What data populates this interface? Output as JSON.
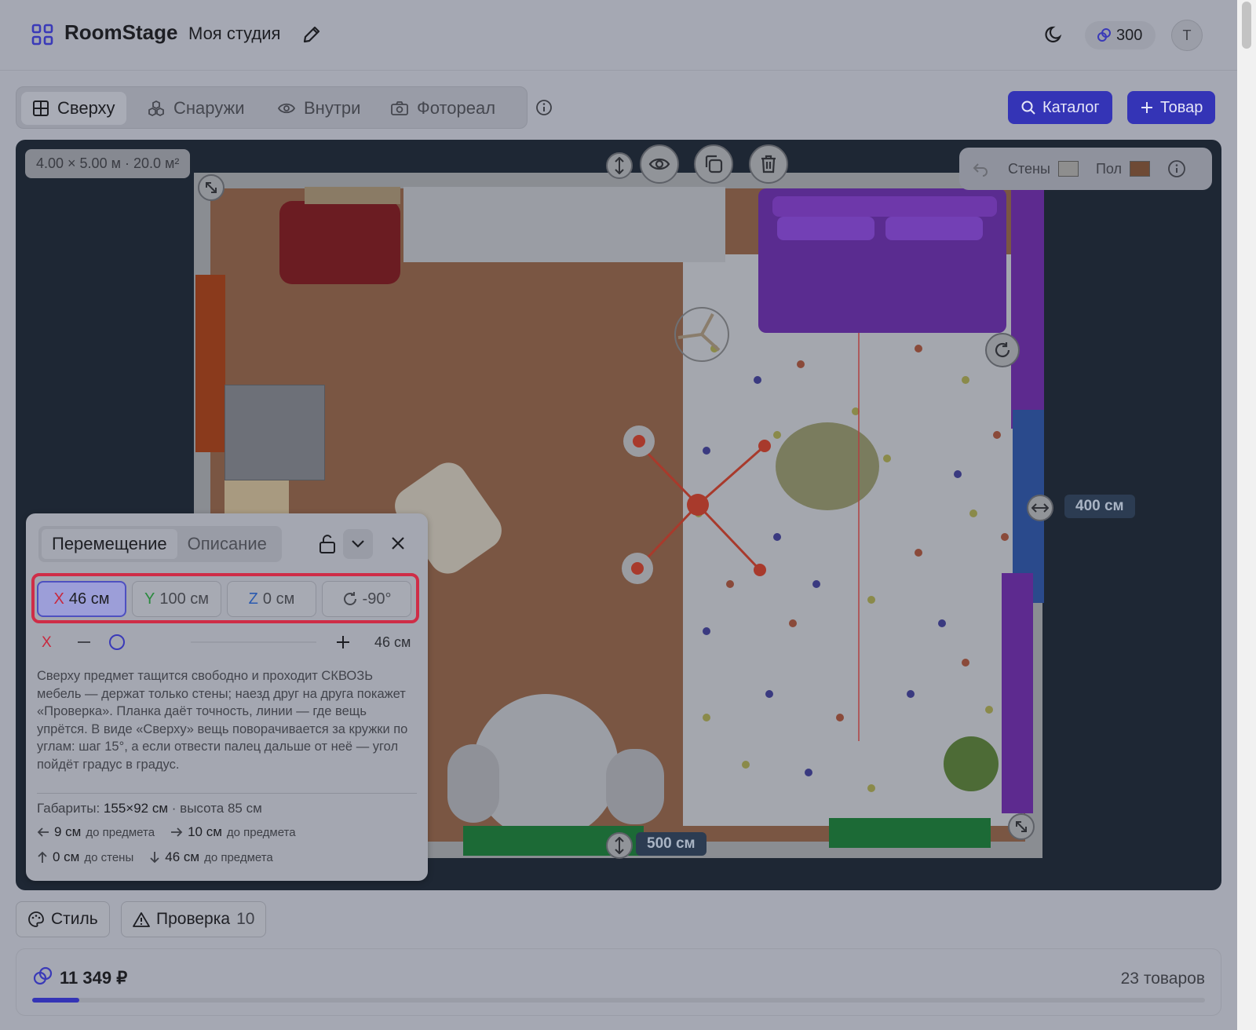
{
  "header": {
    "brand": "RoomStage",
    "studio_name": "Моя студия",
    "credits": "300",
    "avatar_initial": "T"
  },
  "tabs": [
    {
      "label": "Сверху",
      "icon": "grid-icon",
      "active": true
    },
    {
      "label": "Снаружи",
      "icon": "cubes-icon",
      "active": false
    },
    {
      "label": "Внутри",
      "icon": "eye-icon",
      "active": false
    },
    {
      "label": "Фотореал",
      "icon": "camera-icon",
      "active": false
    }
  ],
  "actions": {
    "catalog_label": "Каталог",
    "add_item_label": "Товар"
  },
  "canvas": {
    "room_dims": "4.00 × 5.00 м · 20.0 м²",
    "width_label": "500 см",
    "height_label": "400 см",
    "walls_label": "Стены",
    "floor_label": "Пол",
    "wall_color": "#8e8e8e",
    "floor_color": "#6e4a35"
  },
  "move_panel": {
    "tab_move": "Перемещение",
    "tab_description": "Описание",
    "x_axis": "X",
    "x_value": "46 см",
    "y_axis": "Y",
    "y_value": "100 см",
    "z_axis": "Z",
    "z_value": "0 см",
    "rotation_value": "-90°",
    "slider_axis": "X",
    "slider_value": "46 см",
    "help_text": "Сверху предмет тащится свободно и проходит СКВОЗЬ мебель — держат только стены; наезд друг на друга покажет «Проверка». Планка даёт точность, линии — где вещь упрётся. В виде «Сверху» вещь поворачивается за кружки по углам: шаг 15°, а если отвести палец дальше от неё — угол пойдёт градус в градус.",
    "dims_label": "Габариты:",
    "dims_value": "155×92 см",
    "dims_height": "· высота 85 см",
    "left_dist": "9 см",
    "left_dist_to": "до предмета",
    "right_dist": "10 см",
    "right_dist_to": "до предмета",
    "top_dist": "0 см",
    "top_dist_to": "до стены",
    "bottom_dist": "46 см",
    "bottom_dist_to": "до предмета"
  },
  "bottom": {
    "style_label": "Стиль",
    "check_label": "Проверка",
    "check_count": "10"
  },
  "footer": {
    "total": "11 349 ₽",
    "items_count": "23 товаров",
    "progress": 0.04
  },
  "colors": {
    "accent": "#3434b6",
    "highlight": "#cf2d47"
  }
}
